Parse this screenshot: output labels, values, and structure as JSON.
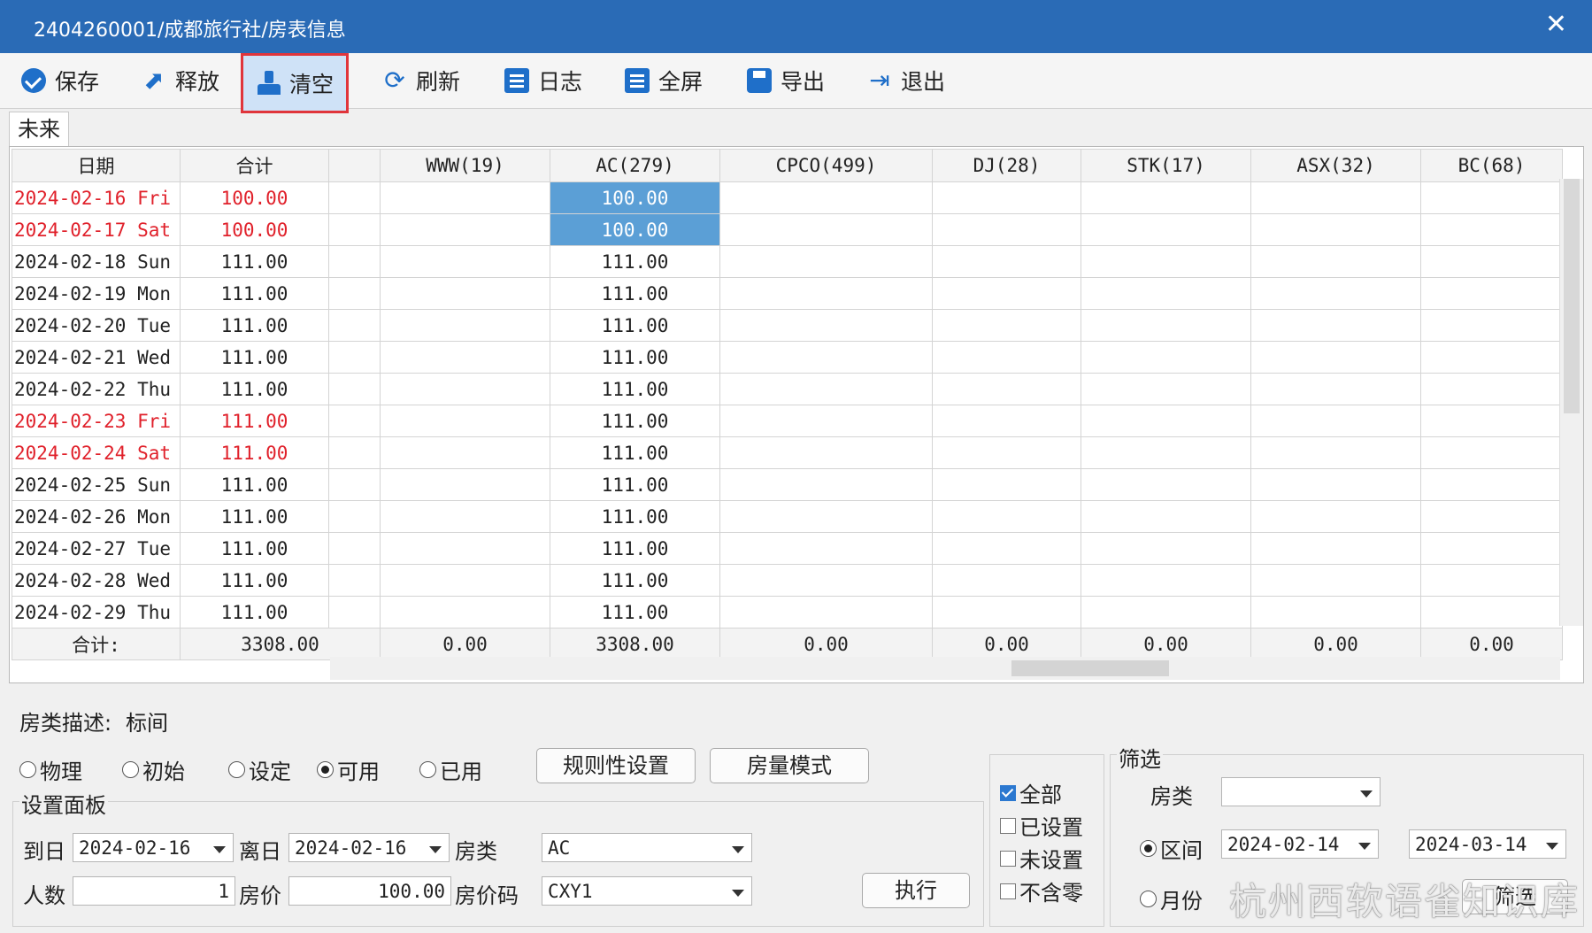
{
  "window": {
    "title": "2404260001/成都旅行社/房表信息",
    "close_glyph": "✕"
  },
  "toolbar": {
    "save": "保存",
    "release": "释放",
    "clear": "清空",
    "refresh": "刷新",
    "log": "日志",
    "fullscreen": "全屏",
    "export": "导出",
    "exit": "退出",
    "release_glyph": "⬈",
    "refresh_glyph": "⟳",
    "exit_glyph": "⇥"
  },
  "tabs": [
    {
      "label": "未来"
    }
  ],
  "grid": {
    "headers": [
      "日期",
      "合计",
      "",
      "WWW(19)",
      "AC(279)",
      "CPCO(499)",
      "DJ(28)",
      "STK(17)",
      "ASX(32)",
      "BC(68)"
    ],
    "rows": [
      {
        "date": "2024-02-16 Fri",
        "total": "100.00",
        "ac": "100.00",
        "weekend": true,
        "selected": true
      },
      {
        "date": "2024-02-17 Sat",
        "total": "100.00",
        "ac": "100.00",
        "weekend": true,
        "selected": true
      },
      {
        "date": "2024-02-18 Sun",
        "total": "111.00",
        "ac": "111.00",
        "weekend": false
      },
      {
        "date": "2024-02-19 Mon",
        "total": "111.00",
        "ac": "111.00",
        "weekend": false
      },
      {
        "date": "2024-02-20 Tue",
        "total": "111.00",
        "ac": "111.00",
        "weekend": false
      },
      {
        "date": "2024-02-21 Wed",
        "total": "111.00",
        "ac": "111.00",
        "weekend": false
      },
      {
        "date": "2024-02-22 Thu",
        "total": "111.00",
        "ac": "111.00",
        "weekend": false
      },
      {
        "date": "2024-02-23 Fri",
        "total": "111.00",
        "ac": "111.00",
        "weekend": true
      },
      {
        "date": "2024-02-24 Sat",
        "total": "111.00",
        "ac": "111.00",
        "weekend": true
      },
      {
        "date": "2024-02-25 Sun",
        "total": "111.00",
        "ac": "111.00",
        "weekend": false
      },
      {
        "date": "2024-02-26 Mon",
        "total": "111.00",
        "ac": "111.00",
        "weekend": false
      },
      {
        "date": "2024-02-27 Tue",
        "total": "111.00",
        "ac": "111.00",
        "weekend": false
      },
      {
        "date": "2024-02-28 Wed",
        "total": "111.00",
        "ac": "111.00",
        "weekend": false
      },
      {
        "date": "2024-02-29 Thu",
        "total": "111.00",
        "ac": "111.00",
        "weekend": false
      }
    ],
    "summary": [
      "合计:",
      "3308.00",
      "0.00",
      "3308.00",
      "0.00",
      "0.00",
      "0.00",
      "0.00",
      "0.00"
    ]
  },
  "panel": {
    "room_desc_label": "房类描述:",
    "room_desc_value": "标间",
    "modes": [
      {
        "label": "物理",
        "checked": false
      },
      {
        "label": "初始",
        "checked": false
      },
      {
        "label": "设定",
        "checked": false
      },
      {
        "label": "可用",
        "checked": true
      },
      {
        "label": "已用",
        "checked": false
      }
    ],
    "rule_button": "规则性设置",
    "quantity_mode_button": "房量模式",
    "settings_title": "设置面板",
    "arrive_label": "到日",
    "arrive_value": "2024-02-16",
    "depart_label": "离日",
    "depart_value": "2024-02-16",
    "room_type_label": "房类",
    "room_type_value": "AC",
    "persons_label": "人数",
    "persons_value": "1",
    "price_label": "房价",
    "price_value": "100.00",
    "price_code_label": "房价码",
    "price_code_value": "CXY1",
    "execute_button": "执行",
    "checks": [
      {
        "label": "全部",
        "checked": true
      },
      {
        "label": "已设置",
        "checked": false
      },
      {
        "label": "未设置",
        "checked": false
      },
      {
        "label": "不含零",
        "checked": false
      }
    ],
    "filter": {
      "title": "筛选",
      "room_type_label": "房类",
      "room_type_value": "",
      "range_label": "区间",
      "range_from": "2024-02-14",
      "range_to": "2024-03-14",
      "month_label": "月份",
      "filter_button": "筛选"
    }
  },
  "watermark": "杭州西软语雀知识库"
}
